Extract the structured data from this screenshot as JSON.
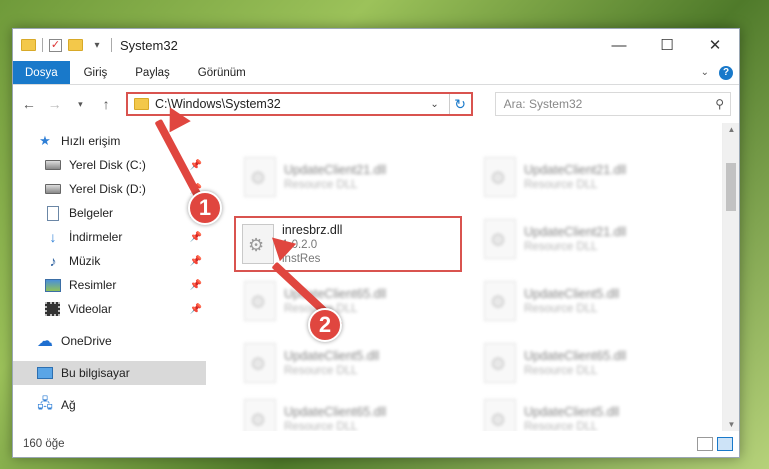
{
  "window": {
    "title": "System32"
  },
  "ribbon": {
    "tabs": [
      "Dosya",
      "Giriş",
      "Paylaş",
      "Görünüm"
    ]
  },
  "address": {
    "path": "C:\\Windows\\System32",
    "search_placeholder": "Ara: System32"
  },
  "nav": {
    "quick_access": "Hızlı erişim",
    "items": [
      "Yerel Disk (C:)",
      "Yerel Disk (D:)",
      "Belgeler",
      "İndirmeler",
      "Müzik",
      "Resimler",
      "Videolar"
    ],
    "onedrive": "OneDrive",
    "this_pc": "Bu bilgisayar",
    "network": "Ağ"
  },
  "files": {
    "highlighted": {
      "name": "inresbrz.dll",
      "version": "1.0.2.0",
      "description": "instRes"
    },
    "blurred": [
      {
        "name": "UpdateClient21.dll",
        "desc": "Resource DLL"
      },
      {
        "name": "UpdateClient21.dll",
        "desc": "Resource DLL"
      },
      {
        "name": "UpdateClient21.dll",
        "desc": "Resource DLL"
      },
      {
        "name": "UpdateClient65.dll",
        "desc": "Resource DLL"
      },
      {
        "name": "UpdateClient5.dll",
        "desc": "Resource DLL"
      },
      {
        "name": "UpdateClient5.dll",
        "desc": "Resource DLL"
      },
      {
        "name": "UpdateClient65.dll",
        "desc": "Resource DLL"
      },
      {
        "name": "UpdateClient65.dll",
        "desc": "Resource DLL"
      },
      {
        "name": "UpdateClient5.dll",
        "desc": "Resource DLL"
      }
    ]
  },
  "status": {
    "count": "160 öğe"
  },
  "annotations": {
    "step1": "1",
    "step2": "2"
  },
  "colors": {
    "accent": "#1979ca",
    "highlight": "#d9534f"
  }
}
